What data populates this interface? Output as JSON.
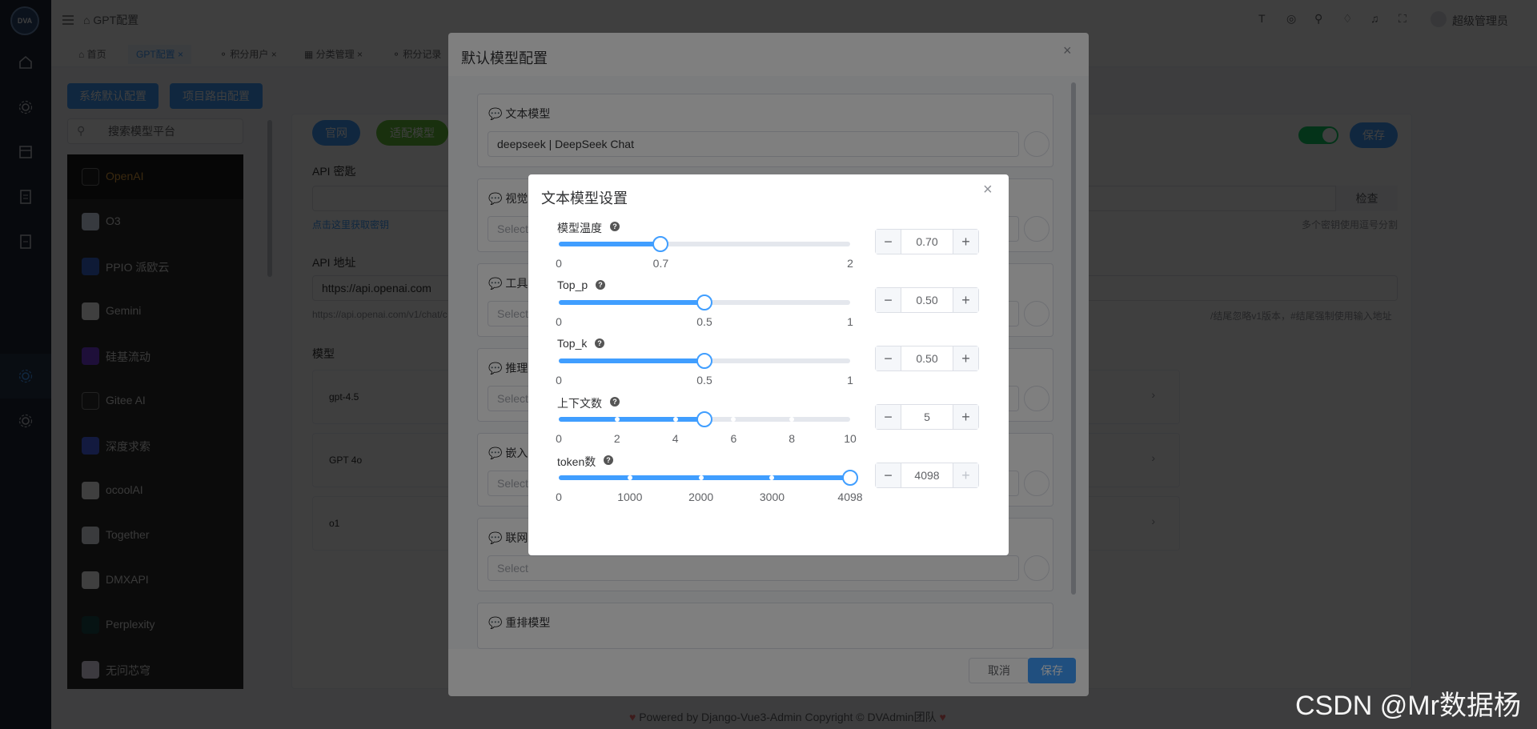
{
  "app": {
    "logo_text": "DVA"
  },
  "header": {
    "breadcrumb": "GPT配置",
    "user": "超级管理员"
  },
  "tabs": [
    {
      "label": "首页"
    },
    {
      "label": "GPT配置"
    },
    {
      "label": "积分用户"
    },
    {
      "label": "分类管理"
    },
    {
      "label": "积分记录"
    }
  ],
  "page": {
    "btn_system_default": "系统默认配置",
    "btn_project_route": "项目路由配置",
    "search_placeholder": "搜索模型平台",
    "providers": [
      "OpenAI",
      "O3",
      "PPIO 派欧云",
      "Gemini",
      "硅基流动",
      "Gitee AI",
      "深度求索",
      "ocoolAI",
      "Together",
      "DMXAPI",
      "Perplexity",
      "无问芯穹"
    ],
    "btn_official": "官网",
    "btn_adapt": "适配模型",
    "api_key_label": "API 密匙",
    "api_key_link": "点击这里获取密钥",
    "check_btn": "检查",
    "key_hint": "多个密钥使用逗号分割",
    "api_url_label": "API 地址",
    "api_url_value": "https://api.openai.com",
    "api_url_hint": "https://api.openai.com/v1/chat/c",
    "api_url_tail_hint": "/结尾忽略v1版本，#结尾强制使用输入地址",
    "model_section": "模型",
    "models": [
      "gpt-4.5",
      "GPT 4o",
      "o1"
    ],
    "save": "保存",
    "footer": "Powered by Django-Vue3-Admin Copyright © DVAdmin团队"
  },
  "dialog_default": {
    "title": "默认模型配置",
    "sections": [
      {
        "title": "文本模型",
        "value": "deepseek | DeepSeek Chat"
      },
      {
        "title": "视觉",
        "value": "Select"
      },
      {
        "title": "工具",
        "value": "Select"
      },
      {
        "title": "推理",
        "value": "Select"
      },
      {
        "title": "嵌入",
        "value": "Select"
      },
      {
        "title": "联网",
        "value": "Select"
      },
      {
        "title": "重排模型",
        "value": ""
      }
    ],
    "cancel": "取消",
    "save": "保存"
  },
  "dialog_text": {
    "title": "文本模型设置",
    "rows": [
      {
        "label": "模型温度",
        "min": 0,
        "max": 2,
        "value": 0.7,
        "display": "0.70",
        "marks": [
          "0",
          "0.7",
          "2"
        ]
      },
      {
        "label": "Top_p",
        "min": 0,
        "max": 1,
        "value": 0.5,
        "display": "0.50",
        "marks": [
          "0",
          "0.5",
          "1"
        ]
      },
      {
        "label": "Top_k",
        "min": 0,
        "max": 1,
        "value": 0.5,
        "display": "0.50",
        "marks": [
          "0",
          "0.5",
          "1"
        ]
      },
      {
        "label": "上下文数",
        "min": 0,
        "max": 10,
        "value": 5,
        "display": "5",
        "marks": [
          "0",
          "2",
          "4",
          "6",
          "8",
          "10"
        ]
      },
      {
        "label": "token数",
        "min": 0,
        "max": 4098,
        "value": 4098,
        "display": "4098",
        "marks": [
          "0",
          "1000",
          "2000",
          "3000",
          "4098"
        ]
      }
    ]
  },
  "watermark": "CSDN @Mr数据杨",
  "colors": {
    "primary": "#409eff",
    "sidebar": "#1d2635",
    "provider_active": "#e6a23c",
    "green": "#67c23a"
  }
}
